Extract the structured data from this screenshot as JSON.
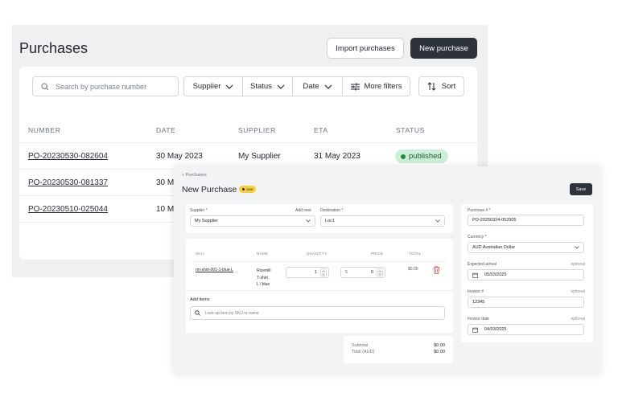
{
  "background_window": {
    "title": "Purchases",
    "import_button": "Import purchases",
    "new_button": "New purchase",
    "search_placeholder": "Search by purchase number",
    "filters": [
      "Supplier",
      "Status",
      "Date",
      "More filters"
    ],
    "sort_label": "Sort",
    "columns": [
      "NUMBER",
      "DATE",
      "SUPPLIER",
      "ETA",
      "STATUS"
    ],
    "rows": [
      {
        "number": "PO-20230530-082604",
        "date": "30 May 2023",
        "supplier": "My Supplier",
        "eta": "31 May 2023",
        "status": "published"
      },
      {
        "number": "PO-20230530-081337",
        "date": "30 M"
      },
      {
        "number": "PO-20230510-025044",
        "date": "10 M"
      }
    ]
  },
  "modal": {
    "breadcrumb": "< Purchases",
    "title": "New Purchase",
    "new_badge": "new",
    "save_button": "Save",
    "supplier": {
      "label": "Supplier *",
      "add_new": "Add new",
      "value": "My Supplier"
    },
    "destination": {
      "label": "Destination *",
      "value": "Loc1"
    },
    "line_items": {
      "columns": [
        "SKU",
        "NAME",
        "QUANTITY",
        "PRICE",
        "TOTAL"
      ],
      "items": [
        {
          "sku": "rm-shirt-001-1-blue-L",
          "name_lines": [
            "Ricemill",
            "T-shirt",
            "L / blue"
          ],
          "quantity": "1",
          "price_prefix": "5",
          "price": "0",
          "total": "$0.00"
        }
      ],
      "add_items_label": "Add items",
      "lookup_placeholder": "Look up item by SKU or name"
    },
    "summary": {
      "subtotal_label": "Subtotal",
      "subtotal_value": "$0.00",
      "total_label": "Total (AUD)",
      "total_value": "$0.00"
    },
    "side": {
      "purchase_number": {
        "label": "Purchase # *",
        "value": "PO-20250324-052905"
      },
      "currency": {
        "label": "Currency *",
        "value": "AUD Australian Dollar"
      },
      "expected_arrival": {
        "label": "Expected arrival",
        "optional": "optional",
        "value": "05/03/2025"
      },
      "invoice_number": {
        "label": "Invoice #",
        "optional": "optional",
        "value": "12345"
      },
      "invoice_date": {
        "label": "Invoice date",
        "optional": "optional",
        "value": "04/03/2025"
      }
    }
  },
  "colors": {
    "primary_dark": "#2d333b",
    "status_green": "#1f8a45",
    "badge_yellow": "#f4d03f",
    "delete_red": "#d9534f"
  }
}
